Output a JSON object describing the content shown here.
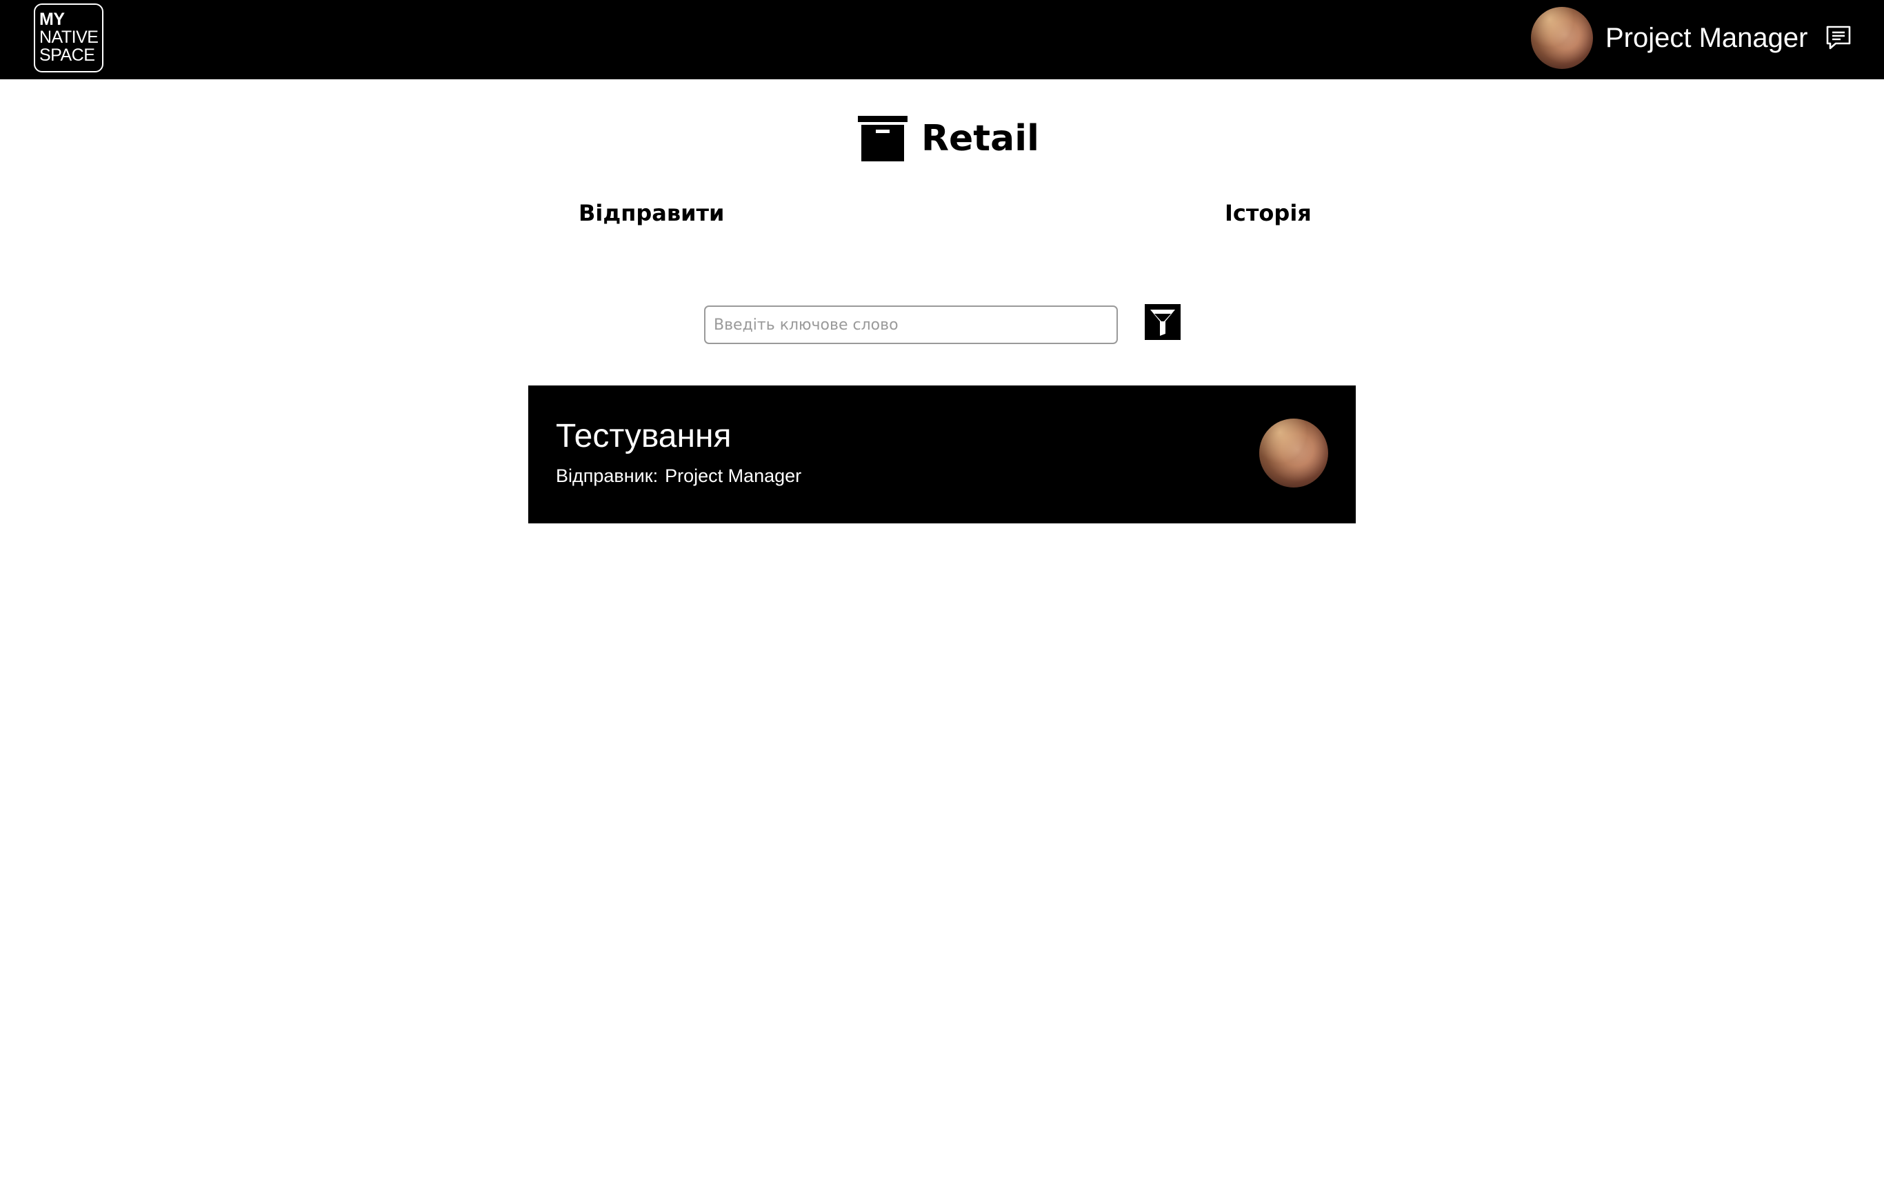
{
  "header": {
    "logo": {
      "line1": "MY",
      "line2": "NATIVE",
      "line3": "SPACE"
    },
    "user_name": "Project Manager",
    "avatar_icon": "user-avatar",
    "chat_icon": "chat-bubble-icon"
  },
  "page": {
    "title": "Retail",
    "title_icon": "archive-box-icon"
  },
  "tabs": [
    {
      "label": "Відправити"
    },
    {
      "label": "Історія"
    }
  ],
  "search": {
    "placeholder": "Введіть ключове слово",
    "value": ""
  },
  "filter_icon": "filter-icon",
  "messages": [
    {
      "title": "Тестування",
      "sender_label": "Відправник:",
      "sender": "Project Manager"
    }
  ],
  "colors": {
    "header_bg": "#000000",
    "card_bg": "#000000",
    "text_on_dark": "#ffffff",
    "input_border": "#9a9a9a"
  }
}
